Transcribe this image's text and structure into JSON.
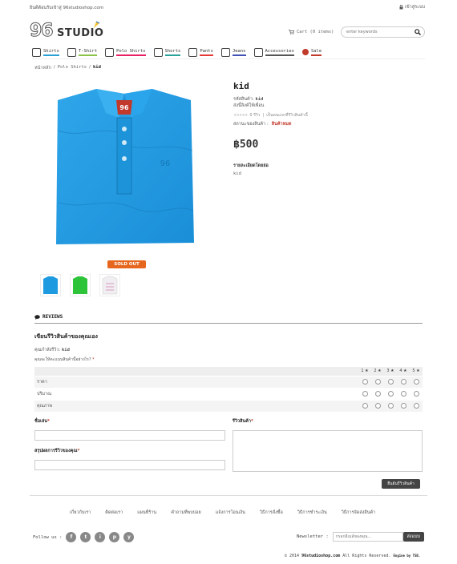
{
  "topbar": {
    "welcome": "ยินดีต้อนรับเข้าสู่ 96studioshop.com",
    "login": "เข้าสู่ระบบ"
  },
  "logo": {
    "number": "96",
    "word": "STUDIO"
  },
  "cart": {
    "label": "Cart (0 items)"
  },
  "search": {
    "placeholder": "enter keywords"
  },
  "nav": [
    {
      "label": "Shirts",
      "color": "#2a9fd6"
    },
    {
      "label": "T-Shirt",
      "color": "#8bc34a"
    },
    {
      "label": "Polo Shirts",
      "color": "#e91e63"
    },
    {
      "label": "Shorts",
      "color": "#2aa198"
    },
    {
      "label": "Pants",
      "color": "#e53935"
    },
    {
      "label": "Jeans",
      "color": "#3f51b5"
    },
    {
      "label": "Accessories",
      "color": "#555555"
    },
    {
      "label": "Sale",
      "color": "#c0392b"
    }
  ],
  "breadcrumb": {
    "home": "หน้าหลัก",
    "category": "Polo Shirts",
    "current": "kid"
  },
  "product": {
    "title": "kid",
    "code_label": "รหัสสินค้า:",
    "code": "kid",
    "share": "ส่งนี้ลิงค์ให้เพื่อน",
    "reviews_count": "0 รีวิว",
    "write_review": "เป็นคนแรกที่รีวิวสินค้านี้",
    "status_label": "สถานะของสินค้า :",
    "status": "สินค้าหมด",
    "price": "฿500",
    "detail_heading": "รายละเอียดโดยย่อ",
    "detail": "kid",
    "sold_out": "SOLD OUT"
  },
  "reviews": {
    "heading": "REVIEWS",
    "title": "เขียนรีวิวสินค้าของคุณเอง",
    "product_label": "คุณกำลังรีวิว:",
    "product_name": "kid",
    "question": "คุณจะให้คะแนนสินค้านี้อย่างไร?",
    "scale": [
      "1 ★",
      "2 ★",
      "3 ★",
      "4 ★",
      "5 ★"
    ],
    "criteria": [
      "ราคา",
      "ปริมาณ",
      "คุณภาพ"
    ],
    "nickname_label": "ชื่อเล่น",
    "summary_label": "สรุปผลการรีวิวของคุณ",
    "review_label": "รีวิวสินค้า",
    "submit": "ยืนยันรีวิวสินค้า"
  },
  "footer": {
    "links": [
      "เกี่ยวกับเรา",
      "ติดต่อเรา",
      "แผนที่ร้าน",
      "คำถามที่พบบ่อย",
      "แจ้งการโอนเงิน",
      "วิธีการสั่งซื้อ",
      "วิธีการชำระเงิน",
      "วิธีการจัดส่งสินค้า"
    ],
    "follow": "Follow us :",
    "social": [
      "f",
      "t",
      "i",
      "p",
      "y"
    ],
    "newsletter_label": "Newsletter :",
    "newsletter_placeholder": "กรอกอีเมล์ของคุณ...",
    "newsletter_button": "ส่งแบบ",
    "copyright_prefix": "© 2014",
    "copyright_site": "96studioshop.com",
    "copyright_suffix": "All Rights Reserved.",
    "engine": "Engine by TSB."
  }
}
